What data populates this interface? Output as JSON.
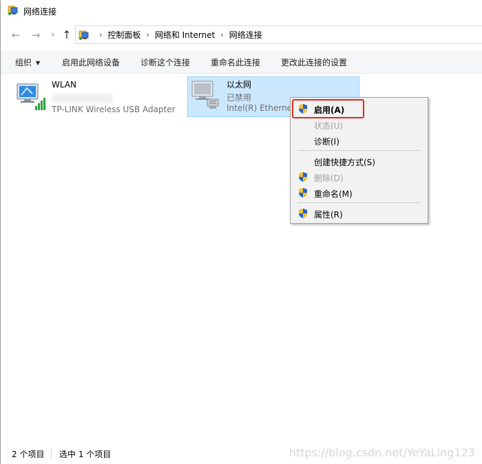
{
  "window": {
    "title": "网络连接"
  },
  "nav": {
    "back_icon": "arrow-left-icon",
    "forward_icon": "arrow-right-icon",
    "recent_icon": "chevron-down-icon",
    "up_icon": "arrow-up-icon"
  },
  "breadcrumb": [
    "控制面板",
    "网络和 Internet",
    "网络连接"
  ],
  "toolbar": {
    "organize": "组织",
    "enable_device": "启用此网络设备",
    "diagnose": "诊断这个连接",
    "rename": "重命名此连接",
    "change_settings": "更改此连接的设置"
  },
  "connections": [
    {
      "name": "WLAN",
      "status": "",
      "device": "TP-LINK Wireless USB Adapter"
    },
    {
      "name": "以太网",
      "status": "已禁用",
      "device": "Intel(R) Ethernet"
    }
  ],
  "context_menu": {
    "items": [
      {
        "label": "启用(A)",
        "enabled": true,
        "bold": true,
        "shield": true
      },
      {
        "label": "状态(U)",
        "enabled": false,
        "shield": false
      },
      {
        "label": "诊断(I)",
        "enabled": true,
        "shield": false
      },
      {
        "label": "创建快捷方式(S)",
        "enabled": true,
        "shield": false
      },
      {
        "label": "删除(D)",
        "enabled": false,
        "shield": true
      },
      {
        "label": "重命名(M)",
        "enabled": true,
        "shield": true
      },
      {
        "label": "属性(R)",
        "enabled": true,
        "shield": true
      }
    ]
  },
  "statusbar": {
    "count": "2 个项目",
    "selected": "选中 1 个项目"
  },
  "watermark": "https://blog.csdn.net/YeYaLing123",
  "colors": {
    "selection_bg": "#cce8ff",
    "highlight_border": "#e0281e",
    "toolbar_bg": "#f5f6f7"
  }
}
